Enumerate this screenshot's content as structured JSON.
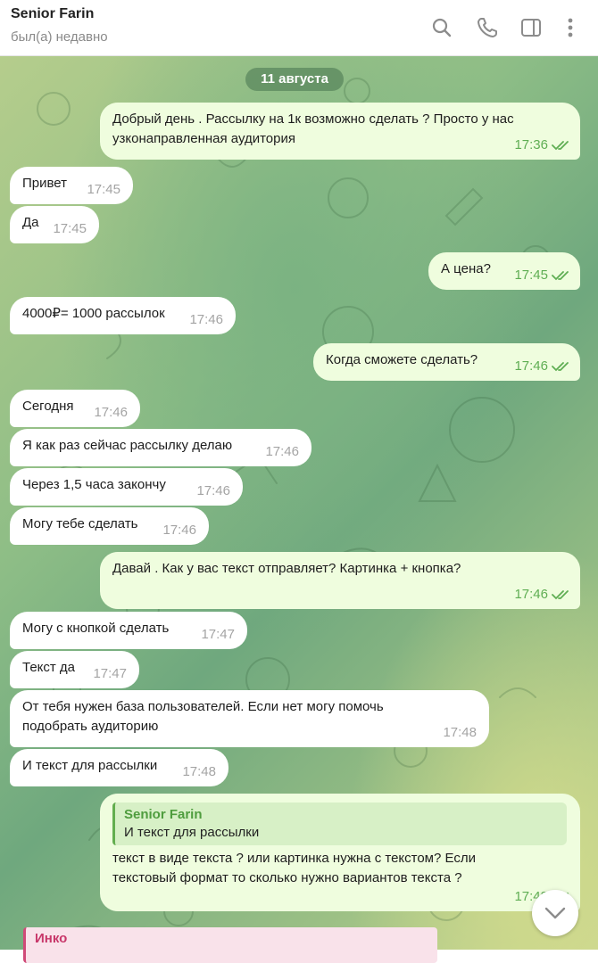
{
  "header": {
    "title": "Senior Farin",
    "status": "был(а) недавно"
  },
  "icons": [
    "search-icon",
    "phone-icon",
    "sidebar-toggle-icon",
    "more-vertical-icon",
    "double-check-icon",
    "chevron-down-icon"
  ],
  "colors": {
    "incoming_bubble": "#ffffff",
    "outgoing_bubble": "#effdde",
    "outgoing_time": "#5fae53",
    "incoming_time": "#a4a4a4",
    "reply_bar": "#63ae4f",
    "partial_reply_bar": "#d04a78"
  },
  "date_label": "11 августа",
  "messages": [
    {
      "dir": "out",
      "lines": [
        "Добрый день . Рассылку на 1к возможно сделать ? Просто у нас",
        "узконаправленная аудитория"
      ],
      "time": "17:36"
    },
    {
      "dir": "in",
      "lines": [
        "Привет"
      ],
      "time": "17:45"
    },
    {
      "dir": "in",
      "lines": [
        "Да"
      ],
      "time": "17:45"
    },
    {
      "dir": "out",
      "lines": [
        "А цена?"
      ],
      "time": "17:45"
    },
    {
      "dir": "in",
      "lines": [
        "4000₽= 1000 рассылок"
      ],
      "time": "17:46"
    },
    {
      "dir": "out",
      "lines": [
        "Когда сможете сделать?"
      ],
      "time": "17:46"
    },
    {
      "dir": "in",
      "lines": [
        "Сегодня"
      ],
      "time": "17:46"
    },
    {
      "dir": "in",
      "lines": [
        "Я как раз сейчас рассылку делаю"
      ],
      "time": "17:46"
    },
    {
      "dir": "in",
      "lines": [
        "Через 1,5 часа закончу"
      ],
      "time": "17:46"
    },
    {
      "dir": "in",
      "lines": [
        "Могу тебе сделать"
      ],
      "time": "17:46"
    },
    {
      "dir": "out",
      "lines": [
        "Давай . Как у вас текст отправляет? Картинка + кнопка?"
      ],
      "time": "17:46"
    },
    {
      "dir": "in",
      "lines": [
        "Могу с кнопкой сделать"
      ],
      "time": "17:47"
    },
    {
      "dir": "in",
      "lines": [
        "Текст да"
      ],
      "time": "17:47"
    },
    {
      "dir": "in",
      "lines": [
        "От тебя нужен база пользователей. Если нет могу помочь",
        "подобрать аудиторию"
      ],
      "time": "17:48"
    },
    {
      "dir": "in",
      "lines": [
        "И текст для рассылки"
      ],
      "time": "17:48"
    },
    {
      "dir": "out",
      "reply_to": {
        "name": "Senior Farin",
        "text": "И текст для рассылки"
      },
      "lines": [
        "текст в виде текста ? или картинка нужна с текстом? Если",
        "текстовый формат то сколько нужно вариантов текста ?"
      ],
      "time": "17:48"
    }
  ],
  "partial_message": {
    "reply_name": "Инко"
  }
}
